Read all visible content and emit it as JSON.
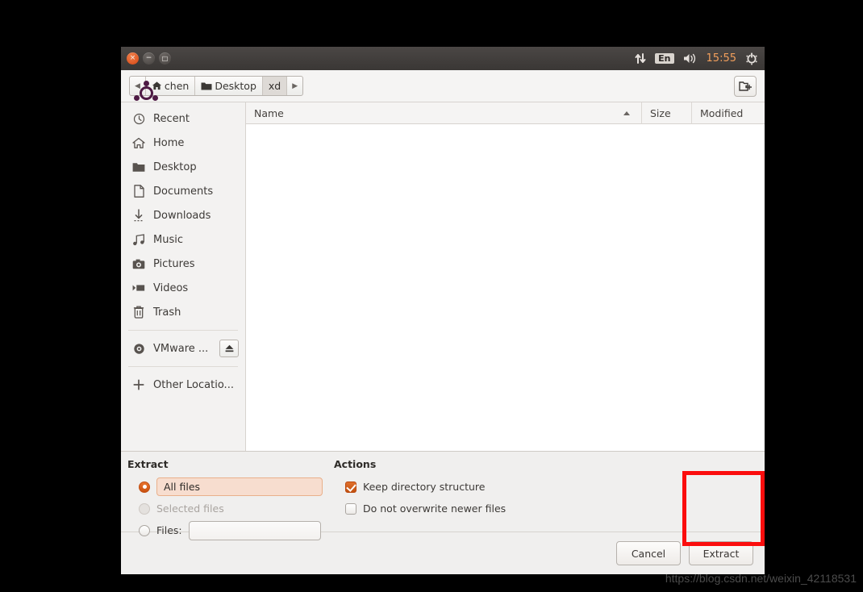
{
  "topbar": {
    "indicators": [
      {
        "name": "network-icon",
        "glyph": "⇅"
      },
      {
        "name": "keyboard-layout",
        "label": "En"
      },
      {
        "name": "volume-icon",
        "glyph": "🔊"
      }
    ],
    "clock": "15:55",
    "power_icon": "power-gear-icon"
  },
  "window": {
    "buttons": {
      "close": "×",
      "minimize": "−",
      "maximize": "□"
    }
  },
  "toolbar": {
    "back_arrow": "◀",
    "forward_arrow": "▶",
    "crumbs": [
      {
        "label": "chen",
        "icon": "home-icon",
        "current": false
      },
      {
        "label": "Desktop",
        "icon": "folder-icon",
        "current": false
      },
      {
        "label": "xd",
        "icon": "none",
        "current": true
      }
    ],
    "new_folder_label": "create-folder-icon"
  },
  "sidebar": {
    "items": [
      {
        "label": "Recent",
        "icon": "clock-icon"
      },
      {
        "label": "Home",
        "icon": "home-icon"
      },
      {
        "label": "Desktop",
        "icon": "folder-icon"
      },
      {
        "label": "Documents",
        "icon": "document-icon"
      },
      {
        "label": "Downloads",
        "icon": "download-icon"
      },
      {
        "label": "Music",
        "icon": "music-note-icon"
      },
      {
        "label": "Pictures",
        "icon": "camera-icon"
      },
      {
        "label": "Videos",
        "icon": "video-icon"
      },
      {
        "label": "Trash",
        "icon": "trash-icon"
      }
    ],
    "devices": [
      {
        "label": "VMware ...",
        "icon": "disc-icon",
        "eject": true
      }
    ],
    "other": {
      "label": "Other Locatio...",
      "icon": "plus-icon"
    }
  },
  "filelist": {
    "columns": [
      {
        "label": "Name",
        "sorted": true
      },
      {
        "label": "Size",
        "sorted": false
      },
      {
        "label": "Modified",
        "sorted": false
      }
    ],
    "rows": []
  },
  "extract_section": {
    "title": "Extract",
    "options": [
      {
        "label": "All files",
        "selected": true,
        "enabled": true,
        "highlighted": true
      },
      {
        "label": "Selected files",
        "selected": false,
        "enabled": false,
        "highlighted": false
      },
      {
        "label": "Files:",
        "selected": false,
        "enabled": true,
        "highlighted": false
      }
    ],
    "files_input_value": "",
    "files_input_placeholder": ""
  },
  "actions_section": {
    "title": "Actions",
    "checkboxes": [
      {
        "label": "Keep directory structure",
        "checked": true
      },
      {
        "label": "Do not overwrite newer files",
        "checked": false
      }
    ]
  },
  "buttons": {
    "cancel": "Cancel",
    "extract": "Extract"
  },
  "annotation": {
    "color": "#fb0d0d",
    "target": "extract-button"
  },
  "watermark": "https://blog.csdn.net/weixin_42118531",
  "launcher": {
    "items": [
      {
        "name": "ubuntu-dash-icon"
      },
      {
        "name": "files-nautilus-icon"
      },
      {
        "name": "firefox-icon"
      },
      {
        "name": "libreoffice-writer-icon"
      },
      {
        "name": "libreoffice-calc-icon"
      },
      {
        "name": "libreoffice-impress-icon"
      },
      {
        "name": "ubuntu-software-icon"
      },
      {
        "name": "amazon-icon"
      }
    ],
    "folded": [
      {
        "name": "archive-manager-icon"
      },
      {
        "name": "disc-burner-icon"
      },
      {
        "name": "printer-icon"
      },
      {
        "name": "dvd-icon"
      }
    ]
  }
}
